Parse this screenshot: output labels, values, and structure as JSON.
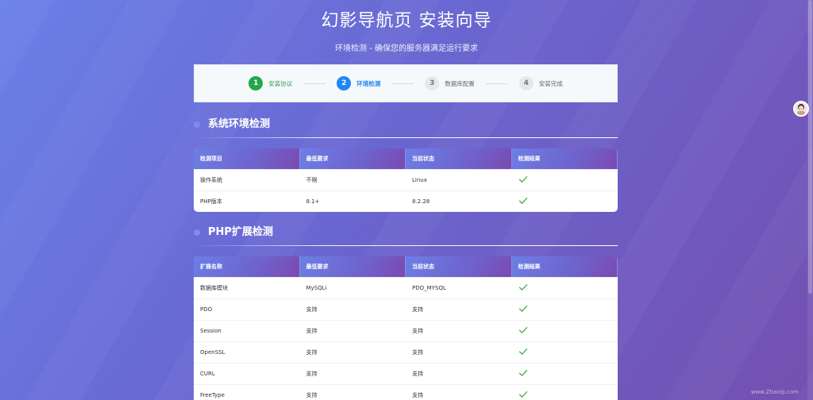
{
  "header": {
    "title": "幻影导航页 安装向导",
    "subtitle": "环境检测 - 确保您的服务器满足运行要求"
  },
  "steps": [
    {
      "num": "1",
      "label": "安装协议",
      "state": "done"
    },
    {
      "num": "2",
      "label": "环境检测",
      "state": "active"
    },
    {
      "num": "3",
      "label": "数据库配置",
      "state": "todo"
    },
    {
      "num": "4",
      "label": "安装完成",
      "state": "todo"
    }
  ],
  "system_section": {
    "title": "系统环境检测",
    "headers": [
      "检测项目",
      "最低要求",
      "当前状态",
      "检测结果"
    ],
    "rows": [
      {
        "name": "操作系统",
        "required": "不限",
        "current": "Linux",
        "result": "check-icon"
      },
      {
        "name": "PHP版本",
        "required": "8.1+",
        "current": "8.2.28",
        "result": "check-icon"
      }
    ]
  },
  "php_section": {
    "title": "PHP扩展检测",
    "headers": [
      "扩展名称",
      "最低要求",
      "当前状态",
      "检测结果"
    ],
    "rows": [
      {
        "name": "数据库模块",
        "required": "MySQLi",
        "current": "PDO_MYSQL",
        "result": "check-icon"
      },
      {
        "name": "PDO",
        "required": "支持",
        "current": "支持",
        "result": "check-icon"
      },
      {
        "name": "Session",
        "required": "支持",
        "current": "支持",
        "result": "check-icon"
      },
      {
        "name": "OpenSSL",
        "required": "支持",
        "current": "支持",
        "result": "check-icon"
      },
      {
        "name": "CURL",
        "required": "支持",
        "current": "支持",
        "result": "check-icon"
      },
      {
        "name": "FreeType",
        "required": "支持",
        "current": "支持",
        "result": "check-icon"
      }
    ]
  },
  "watermark": "www.Zhaoip.com",
  "colors": {
    "done": "#22a84a",
    "active": "#1e88f5",
    "check": "#4caf50"
  }
}
